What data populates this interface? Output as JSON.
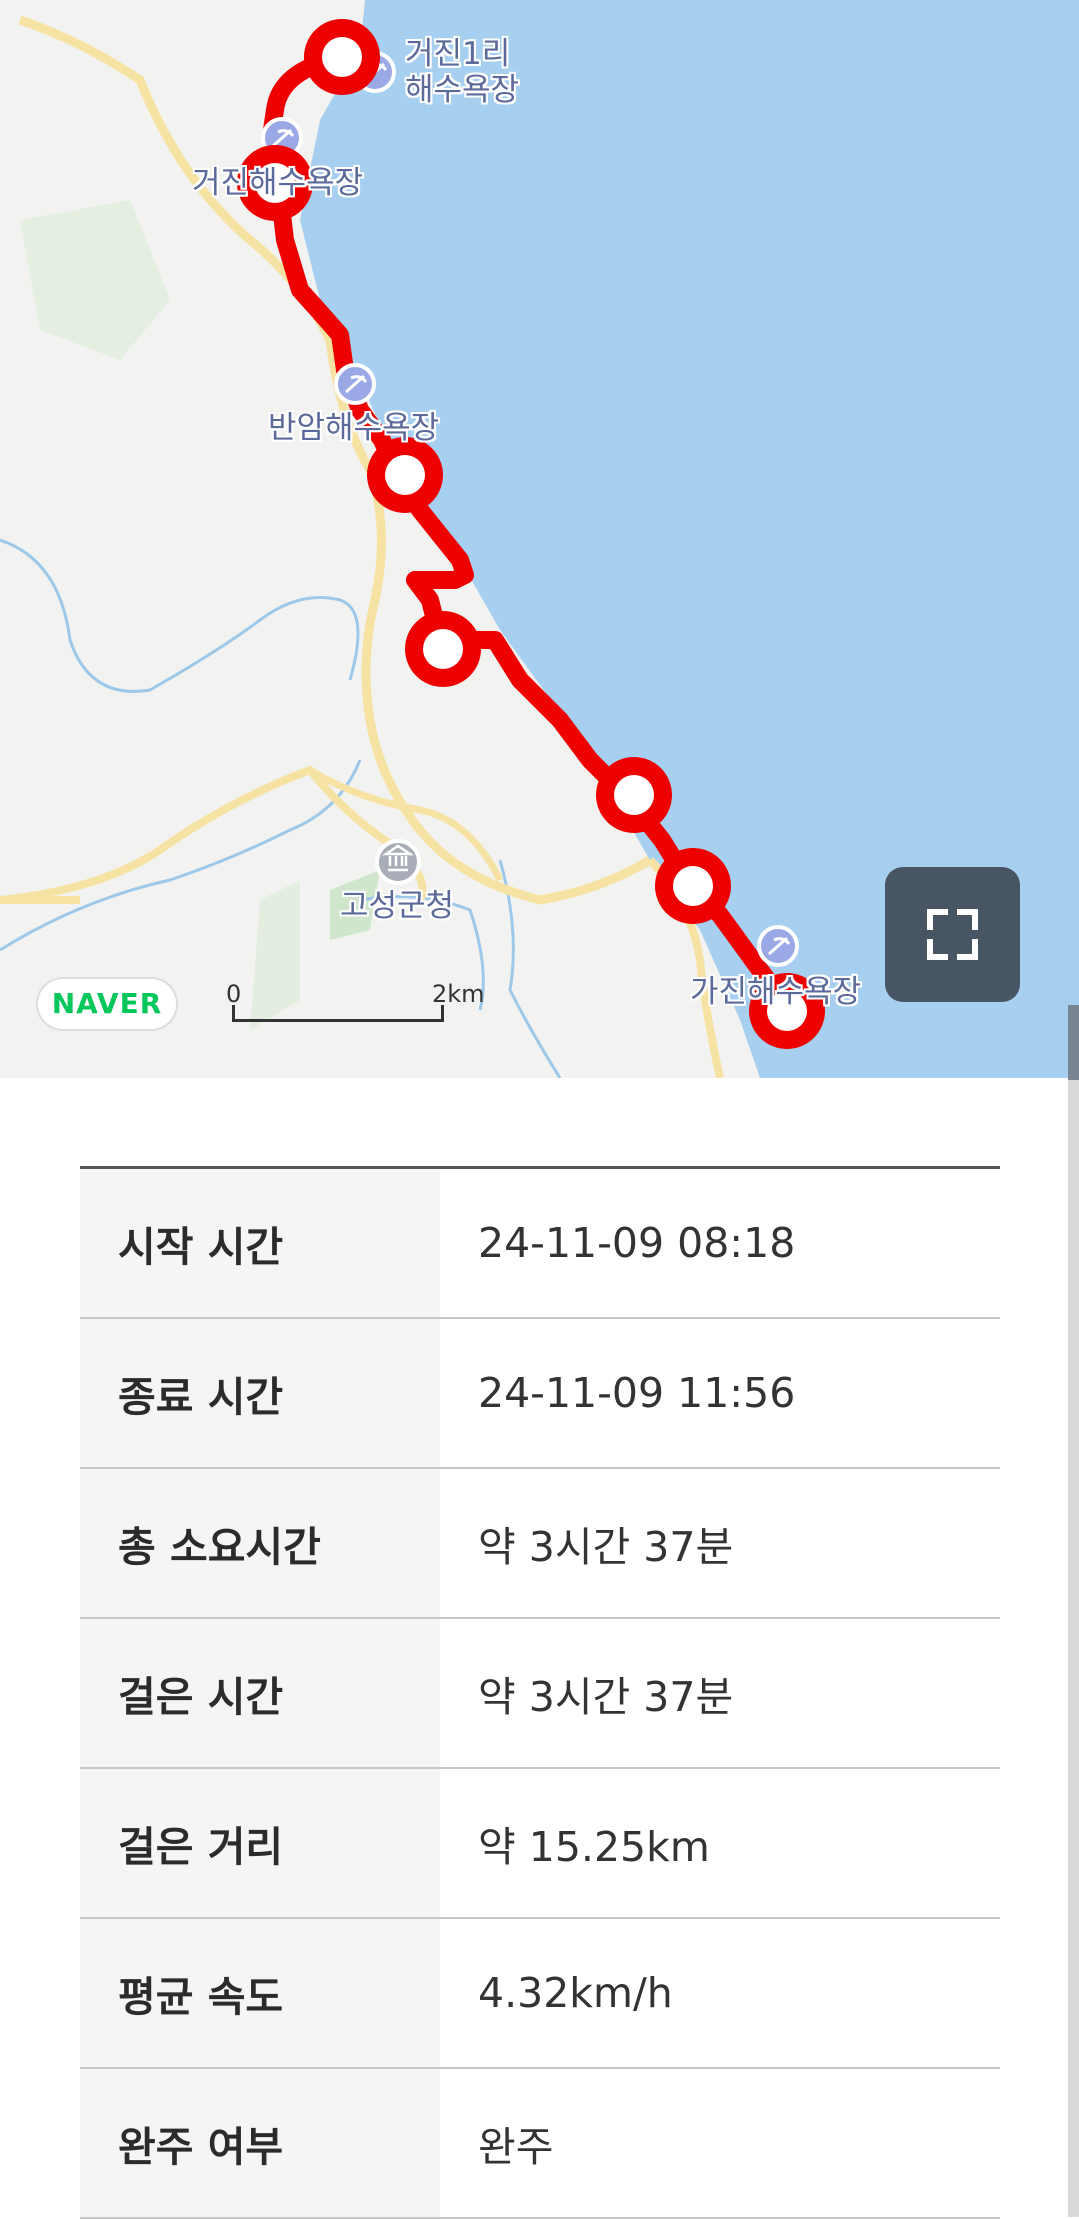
{
  "map": {
    "places": [
      {
        "name": "거진1리\n해수욕장"
      },
      {
        "name": "거진해수욕장"
      },
      {
        "name": "반암해수욕장"
      },
      {
        "name": "고성군청"
      },
      {
        "name": "가진해수욕장"
      }
    ],
    "provider_logo": "NAVER",
    "scale": {
      "start": "0",
      "end": "2km"
    },
    "fullscreen_icon": "fullscreen-icon",
    "route_color": "#ee0000",
    "sea_color": "#a6cff0"
  },
  "records": [
    {
      "label": "시작 시간",
      "value": "24-11-09 08:18"
    },
    {
      "label": "종료 시간",
      "value": "24-11-09 11:56"
    },
    {
      "label": "총 소요시간",
      "value": "약 3시간 37분"
    },
    {
      "label": "걸은 시간",
      "value": "약 3시간 37분"
    },
    {
      "label": "걸은 거리",
      "value": "약 15.25km"
    },
    {
      "label": "평균 속도",
      "value": "4.32km/h"
    },
    {
      "label": "완주 여부",
      "value": "완주"
    }
  ]
}
